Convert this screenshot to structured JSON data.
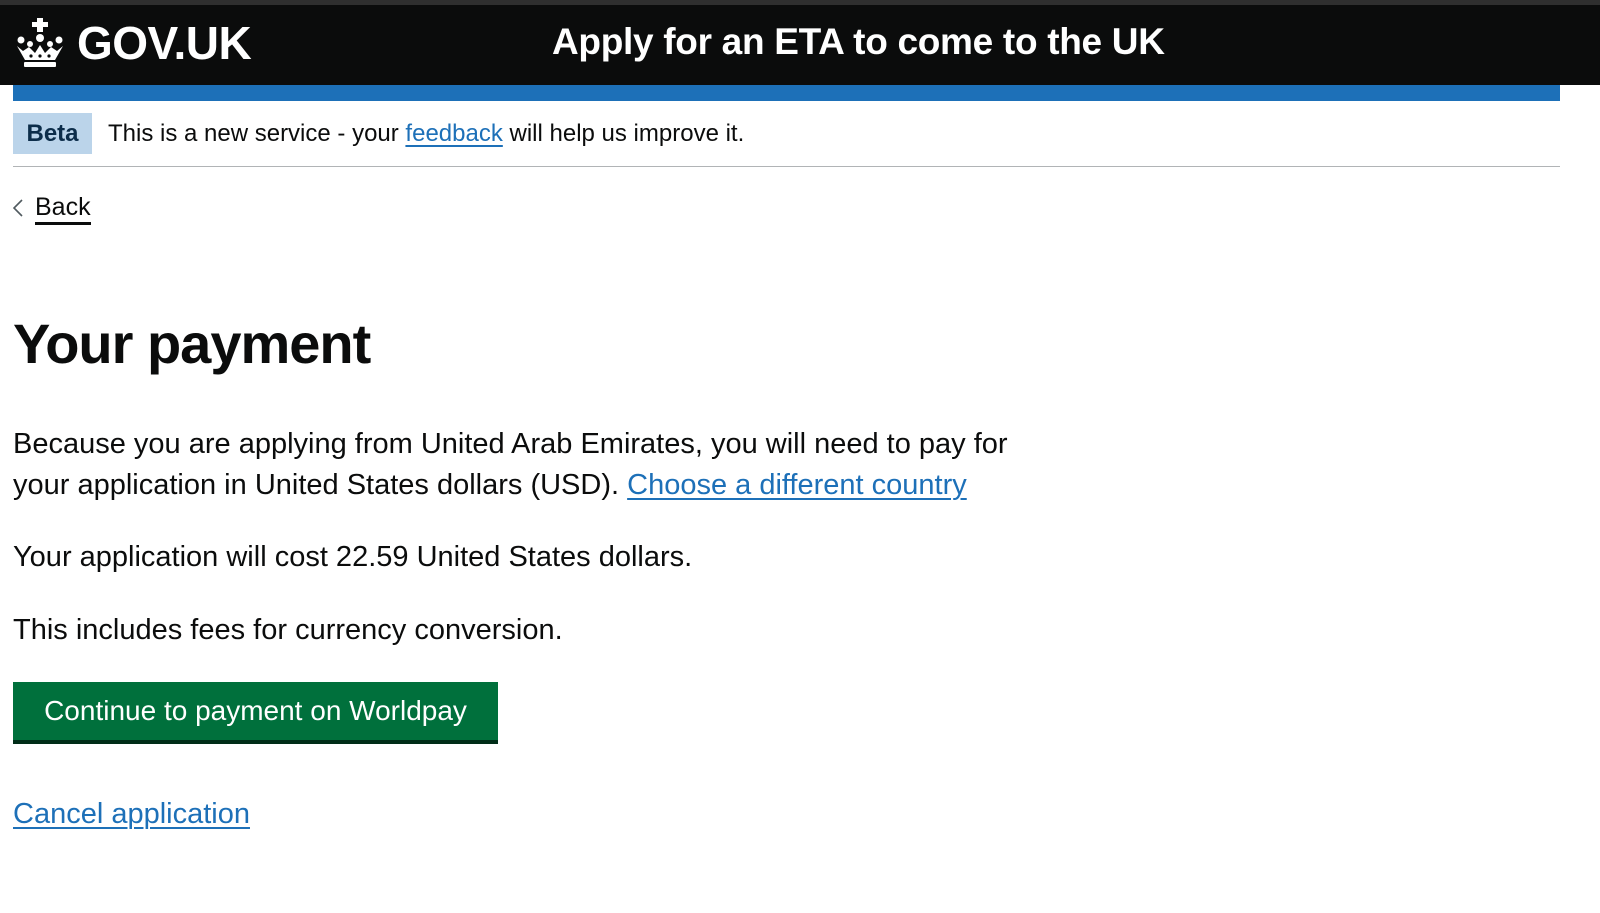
{
  "header": {
    "logo_text": "GOV.UK",
    "service_name": "Apply for an ETA to come to the UK"
  },
  "phase_banner": {
    "tag": "Beta",
    "text_before": "This is a new service - your ",
    "link_text": "feedback",
    "text_after": " will help us improve it."
  },
  "back_link": {
    "label": "Back"
  },
  "main": {
    "heading": "Your payment",
    "intro_text": "Because you are applying from United Arab Emirates, you will need to pay for your application in United States dollars (USD).",
    "change_country_link": "Choose a different country",
    "cost_text": "Your application will cost 22.59 United States dollars.",
    "fees_text": "This includes fees for currency conversion.",
    "continue_button": "Continue to payment on Worldpay",
    "cancel_link": "Cancel application"
  },
  "colors": {
    "header_bg": "#0b0c0c",
    "blue_bar": "#1d70b8",
    "link": "#1d70b8",
    "button_green": "#00703c",
    "beta_tag_bg": "#bbd4ea"
  },
  "icons": {
    "logo": "crown-icon",
    "back": "chevron-left-icon"
  }
}
